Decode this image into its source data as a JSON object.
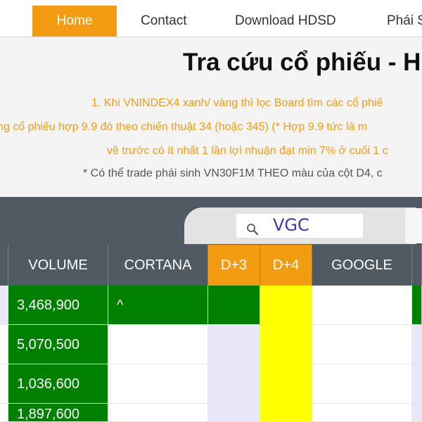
{
  "nav": {
    "items": [
      "Home",
      "Contact",
      "Download HDSD",
      "Phái S"
    ]
  },
  "header": {
    "title": "Tra cứu cổ phiếu - H",
    "lines": [
      "1. Khi VNINDEX4 xanh/ vàng thì lọc Board tìm các cổ phiế",
      "ng cổ phiếu hợp 9.9 đó theo chiến thuật 34 (hoặc 345) (* Hợp 9.9 tức là m",
      "về trước có ít nhất 1 lần lợi nhuận đạt min 7% ở cuối 1 c",
      "* Có thể trade phái sinh VN30F1M THEO màu của cột D4, c"
    ]
  },
  "search": {
    "value": "VGC",
    "icon": "search-icon"
  },
  "table": {
    "headers": [
      "VOLUME",
      "CORTANA",
      "D+3",
      "D+4",
      "GOOGLE"
    ],
    "rows": [
      {
        "volume": "3,468,900",
        "cortana": "^"
      },
      {
        "volume": "5,070,500",
        "cortana": ""
      },
      {
        "volume": "1,036,600",
        "cortana": ""
      },
      {
        "volume": "1,897,600",
        "cortana": ""
      }
    ]
  },
  "colors": {
    "accent": "#f39c12",
    "dark": "#505a63",
    "green": "#008000",
    "yellow": "#ffff00",
    "lavender": "#e8e8f8"
  }
}
